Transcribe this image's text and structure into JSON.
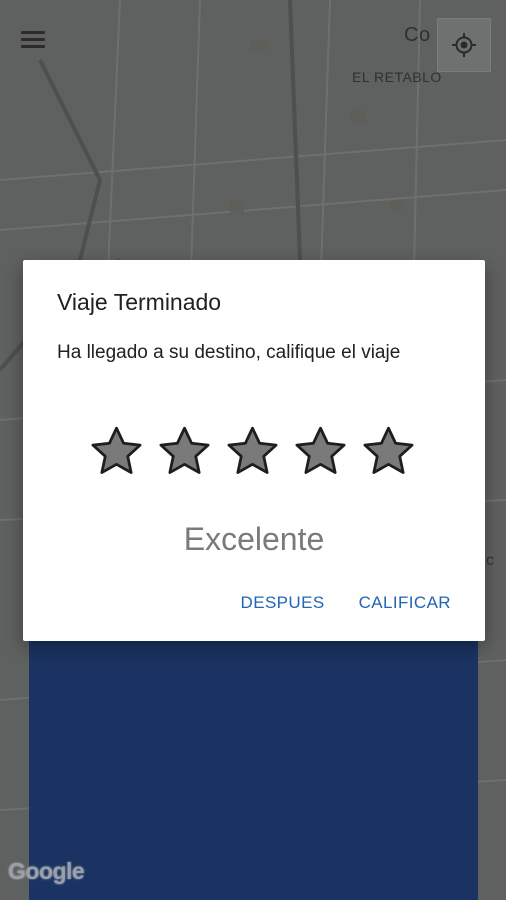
{
  "map": {
    "label_top": "Co",
    "label_retablo": "EL RETABLO",
    "label_right": "c",
    "attribution": "Google"
  },
  "icons": {
    "menu": "hamburger-menu-icon",
    "locate": "my-location-icon",
    "star": "star-icon"
  },
  "dialog": {
    "title": "Viaje Terminado",
    "message": "Ha llegado a su destino, califique el viaje",
    "stars": [
      1,
      1,
      1,
      1,
      1
    ],
    "rating": 5,
    "rating_label": "Excelente",
    "buttons": {
      "later": "DESPUES",
      "rate": "CALIFICAR"
    }
  },
  "colors": {
    "accent": "#2265b5",
    "panel": "#1b3363",
    "star_fill": "#7a7a7a",
    "star_stroke": "#1e1e1e"
  }
}
